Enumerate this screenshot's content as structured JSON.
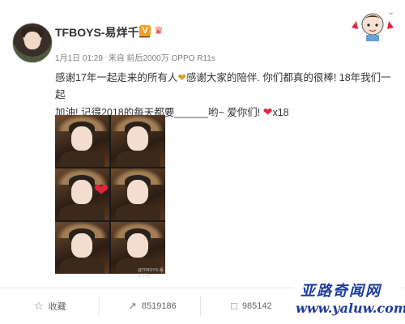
{
  "post": {
    "author": "TFBOYS-易烊千玺",
    "verified_badge": "V",
    "meta": {
      "date": "1月1日 01:29",
      "source": "来自 前后2000万 OPPO R11s"
    },
    "text_line1": "感谢17年一起走来的所有人",
    "text_line1b": "感谢大家的陪伴. 你们都真的很棒! 18年我们一起",
    "text_line2": "加油! 记得2018的每天都要______哟~ 爱你们!",
    "text_suffix": "x18",
    "photo_credit": "@TFBOYS-易烊千玺"
  },
  "actions": {
    "favorite_label": "收藏",
    "repost_count": "8519186",
    "comment_count": "985142"
  },
  "watermark": {
    "title": "亚路奇闻网",
    "url": "www.yaluw.com"
  },
  "icons": {
    "chevron": "chevron-down-icon",
    "star": "favorite-icon",
    "repost": "repost-icon",
    "comment": "comment-icon",
    "gold_heart": "gold-heart-icon",
    "red_heart": "red-heart-icon"
  },
  "colors": {
    "accent_badge": "#f0a020",
    "heart": "#e0273a",
    "watermark": "#1d3a9e"
  }
}
